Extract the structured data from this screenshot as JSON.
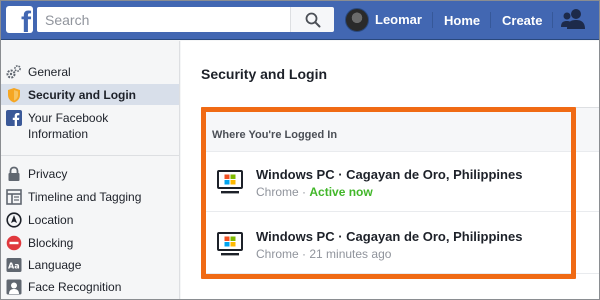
{
  "topbar": {
    "search_placeholder": "Search",
    "user_name": "Leomar",
    "nav": [
      "Home",
      "Create"
    ]
  },
  "sidebar": {
    "items": [
      {
        "label": "General",
        "icon": "gear-icon"
      },
      {
        "label": "Security and Login",
        "icon": "shield-icon",
        "active": true
      },
      {
        "label": "Your Facebook Information",
        "icon": "facebook-icon"
      },
      {
        "label": "Privacy",
        "icon": "lock-icon"
      },
      {
        "label": "Timeline and Tagging",
        "icon": "timeline-icon"
      },
      {
        "label": "Location",
        "icon": "location-icon"
      },
      {
        "label": "Blocking",
        "icon": "block-icon"
      },
      {
        "label": "Language",
        "icon": "language-icon"
      },
      {
        "label": "Face Recognition",
        "icon": "face-recognition-icon"
      }
    ]
  },
  "main": {
    "title": "Security and Login",
    "section_header": "Where You're Logged In",
    "sessions": [
      {
        "device": "Windows PC · Cagayan de Oro, Philippines",
        "browser": "Chrome",
        "status": "Active now",
        "status_active": true
      },
      {
        "device": "Windows PC · Cagayan de Oro, Philippines",
        "browser": "Chrome",
        "status": "21 minutes ago",
        "status_active": false
      }
    ]
  },
  "colors": {
    "brand": "#4267b2",
    "active_green": "#42b72a",
    "highlight_orange": "#f06a14"
  }
}
